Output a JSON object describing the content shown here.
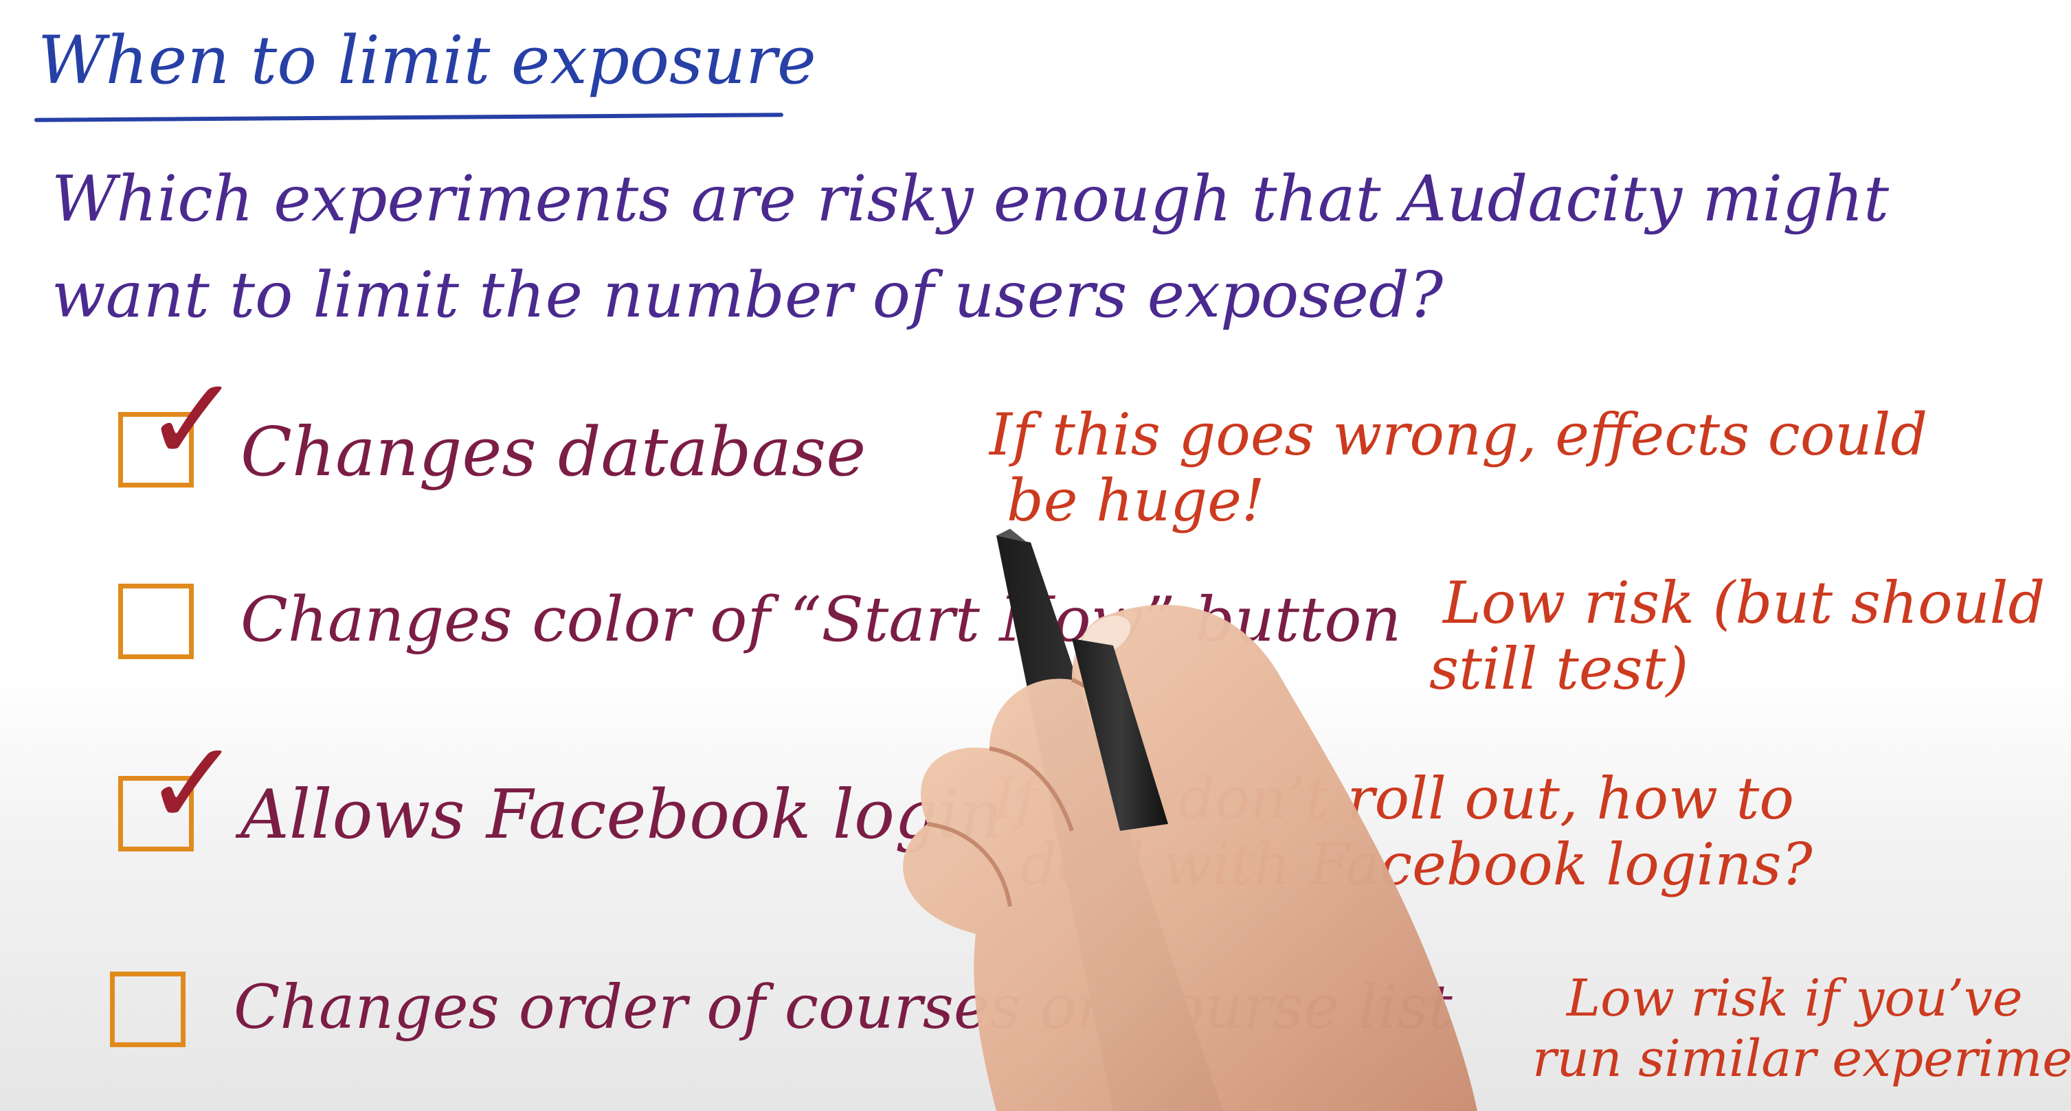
{
  "title": "When to limit exposure",
  "question": {
    "line1": "Which experiments are risky enough that Audacity might",
    "line2": "want to limit the number of users exposed?"
  },
  "items": [
    {
      "label": "Changes database",
      "checked": true,
      "note_line1": "If this goes wrong, effects could",
      "note_line2": "be huge!"
    },
    {
      "label": "Changes color of “Start Now” button",
      "checked": false,
      "note_line1": "Low risk (but should",
      "note_line2": "still test)"
    },
    {
      "label": "Allows Facebook login",
      "checked": true,
      "note_line1": "If you don’t roll out, how to",
      "note_line2": "deal with Facebook logins?"
    },
    {
      "label": "Changes order of courses on course list",
      "checked": false,
      "note_line1": "Low risk if you’ve",
      "note_line2": "run similar experiments"
    }
  ],
  "colors": {
    "title": "#2740a6",
    "question": "#4a2a8f",
    "items": "#7b1d45",
    "notes": "#cc3a1f",
    "checkbox": "#e08a1e"
  }
}
